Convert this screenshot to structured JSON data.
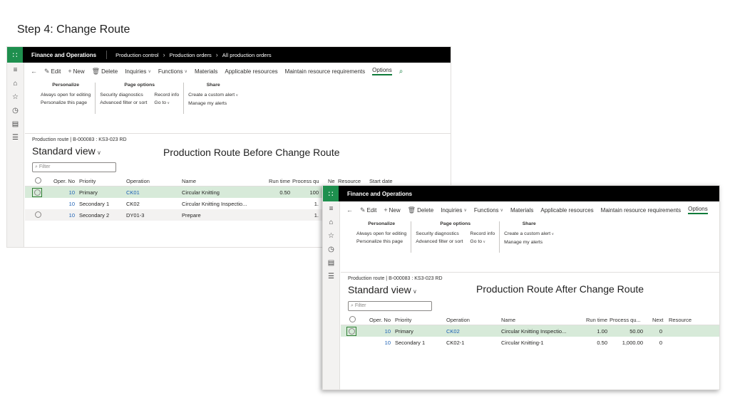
{
  "slide_title": "Step 4: Change Route",
  "app": {
    "name": "Finance and Operations",
    "breadcrumb": [
      "Production control",
      "Production orders",
      "All production orders"
    ]
  },
  "toolbar": {
    "edit": "Edit",
    "new": "New",
    "delete": "Delete",
    "inquiries": "Inquiries",
    "functions": "Functions",
    "materials": "Materials",
    "applicable_resources": "Applicable resources",
    "maintain_resource_requirements": "Maintain resource requirements",
    "options": "Options"
  },
  "options_groups": {
    "personalize": {
      "title": "Personalize",
      "items": [
        "Always open for editing",
        "Personalize this page"
      ]
    },
    "page_options": {
      "title": "Page options",
      "col1": [
        "Security diagnostics",
        "Advanced filter or sort"
      ],
      "col2": [
        "Record info",
        "Go to"
      ]
    },
    "share": {
      "title": "Share",
      "items": [
        "Create a custom alert",
        "Manage my alerts"
      ]
    }
  },
  "page": {
    "record_title": "Production route  |  B-000083 : KS3-023 RD",
    "view_name": "Standard view",
    "filter_placeholder": "Filter"
  },
  "before": {
    "callout": "Production Route Before Change Route",
    "headers": [
      "Oper. No.",
      "Priority",
      "Operation",
      "Name",
      "Run time",
      "Process qu...",
      "Next",
      "Resource",
      "Start date"
    ],
    "rows": [
      {
        "oper_no": "10",
        "priority": "Primary",
        "operation": "CK01",
        "name": "Circular Knitting",
        "run_time": "0.50",
        "process_qty": "100"
      },
      {
        "oper_no": "10",
        "priority": "Secondary 1",
        "operation": "CK02",
        "name": "Circular Knitting Inspectio...",
        "run_time": "",
        "process_qty": "1."
      },
      {
        "oper_no": "10",
        "priority": "Secondary 2",
        "operation": "DY01-3",
        "name": "Prepare",
        "run_time": "",
        "process_qty": "1."
      }
    ]
  },
  "after": {
    "callout": "Production Route After Change Route",
    "headers": [
      "Oper. No.",
      "Priority",
      "Operation",
      "Name",
      "Run time",
      "Process qu...",
      "Next",
      "Resource"
    ],
    "rows": [
      {
        "oper_no": "10",
        "priority": "Primary",
        "operation": "CK02",
        "name": "Circular Knitting Inspectio...",
        "run_time": "1.00",
        "process_qty": "50.00",
        "next": "0"
      },
      {
        "oper_no": "10",
        "priority": "Secondary 1",
        "operation": "CK02-1",
        "name": "Circular Knitting-1",
        "run_time": "0.50",
        "process_qty": "1,000.00",
        "next": "0"
      }
    ]
  },
  "icons": [
    "waffle-icon",
    "hamburger-icon",
    "home-icon",
    "star-icon",
    "clock-icon",
    "workspace-icon",
    "list-icon",
    "back-arrow-icon",
    "edit-icon",
    "plus-icon",
    "delete-icon",
    "search-icon",
    "chevron-right-icon",
    "chevron-down-icon",
    "filter-icon",
    "radio-icon"
  ]
}
